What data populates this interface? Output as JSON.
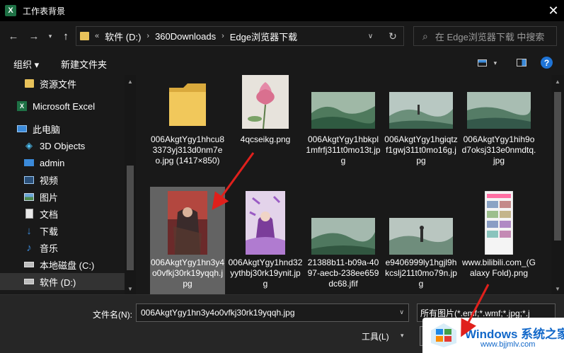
{
  "window": {
    "title": "工作表背景",
    "app_icon_letter": "X"
  },
  "nav": {
    "breadcrumb_overflow": "«",
    "crumbs": [
      "软件 (D:)",
      "360Downloads",
      "Edge浏览器下载"
    ],
    "search_placeholder": "在 Edge浏览器下载 中搜索"
  },
  "toolbar": {
    "organize": "组织 ▾",
    "new_folder": "新建文件夹"
  },
  "sidebar": {
    "items": [
      {
        "label": "资源文件",
        "icon": "folder-icon"
      },
      {
        "label": "Microsoft Excel",
        "icon": "excel-icon"
      },
      {
        "label": "此电脑",
        "icon": "computer-icon"
      },
      {
        "label": "3D Objects",
        "icon": "cube-icon"
      },
      {
        "label": "admin",
        "icon": "monitor-icon"
      },
      {
        "label": "视频",
        "icon": "video-icon"
      },
      {
        "label": "图片",
        "icon": "picture-icon"
      },
      {
        "label": "文档",
        "icon": "document-icon"
      },
      {
        "label": "下载",
        "icon": "download-icon"
      },
      {
        "label": "音乐",
        "icon": "music-icon"
      },
      {
        "label": "本地磁盘 (C:)",
        "icon": "drive-icon"
      },
      {
        "label": "软件 (D:)",
        "icon": "drive-icon"
      }
    ]
  },
  "files": [
    {
      "name": "006AkgtYgy1hhcu83373yj313d0nm7eo.jpg (1417×850)",
      "kind": "folder"
    },
    {
      "name": "4qcseikg.png",
      "kind": "lotus"
    },
    {
      "name": "006AkgtYgy1hbkpl1mfrfj311t0mo13t.jpg",
      "kind": "landscape"
    },
    {
      "name": "006AkgtYgy1hgiqtzf1gwj311t0mo16g.jpg",
      "kind": "landscape"
    },
    {
      "name": "006AkgtYgy1hih9od7oksj313e0nmdtq.jpg",
      "kind": "landscape"
    },
    {
      "name": "006AkgtYgy1hn3y4o0vfkj30rk19yqqh.jpg",
      "kind": "portrait-red",
      "selected": true
    },
    {
      "name": "006AkgtYgy1hnd32yythbj30rk19ynit.jpg",
      "kind": "portrait-purple"
    },
    {
      "name": "21388b11-b09a-4097-aecb-238ee659dc68.jfif",
      "kind": "landscape"
    },
    {
      "name": "e9406999ly1hgjl9hkcslj211t0mo79n.jpg",
      "kind": "landscape"
    },
    {
      "name": "www.bilibili.com_(Galaxy Fold).png",
      "kind": "phone"
    }
  ],
  "footer": {
    "filename_label": "文件名(N):",
    "filename_value": "006AkgtYgy1hn3y4o0vfkj30rk19yqqh.jpg",
    "type_value": "所有图片(*.emf;*.wmf;*.jpg;*.j",
    "tools_label": "工具(L)"
  },
  "watermark": {
    "title": "Windows 系统之家",
    "url": "www.bjjmlv.com"
  },
  "colors": {
    "accent_red": "#e0201c",
    "folder_yellow": "#e8c25a",
    "help_blue": "#1f74d6"
  }
}
